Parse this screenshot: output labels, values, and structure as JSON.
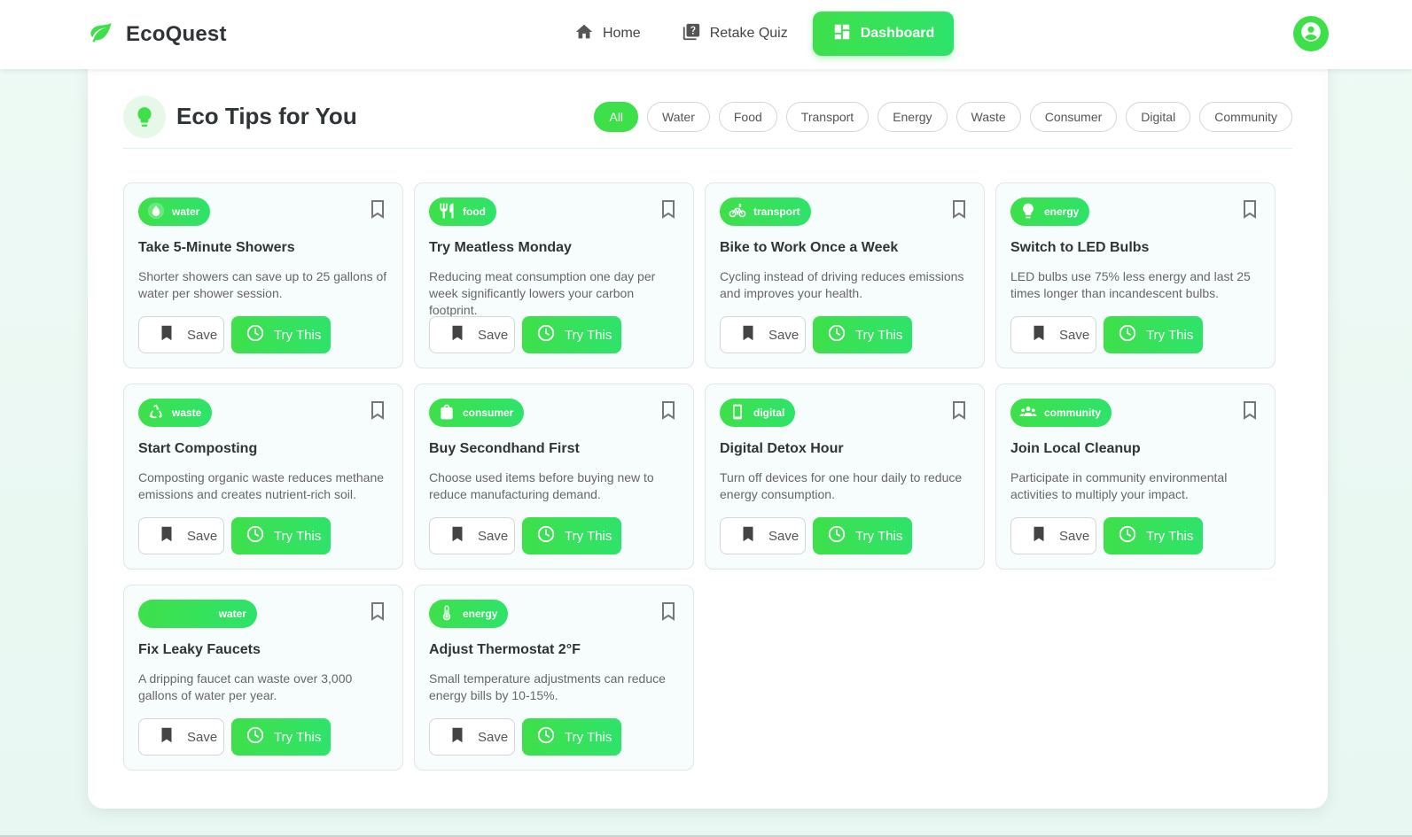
{
  "brand": {
    "name": "EcoQuest",
    "icon": "leaf-icon"
  },
  "nav": [
    {
      "label": "Home",
      "icon": "home-icon",
      "active": false
    },
    {
      "label": "Retake Quiz",
      "icon": "quiz-icon",
      "active": false
    },
    {
      "label": "Dashboard",
      "icon": "dashboard-icon",
      "active": true
    }
  ],
  "user": {
    "icon": "user-avatar-icon"
  },
  "section": {
    "title": "Eco Tips for You",
    "icon": "lightbulb-icon"
  },
  "filters": [
    "All",
    "Water",
    "Food",
    "Transport",
    "Energy",
    "Waste",
    "Consumer",
    "Digital",
    "Community"
  ],
  "active_filter": "All",
  "buttons": {
    "save": "Save",
    "try": "Try This"
  },
  "colors": {
    "accent": "#3ee04a",
    "accent_alt": "#2ee36a",
    "text": "#2f3437"
  },
  "tips": [
    {
      "category": "water",
      "icon": "water-drop-icon",
      "title": "Take 5-Minute Showers",
      "description": "Shorter showers can save up to 25 gallons of water per shower session."
    },
    {
      "category": "food",
      "icon": "fork-knife-icon",
      "title": "Try Meatless Monday",
      "description": "Reducing meat consumption one day per week significantly lowers your carbon footprint."
    },
    {
      "category": "transport",
      "icon": "bicycle-icon",
      "title": "Bike to Work Once a Week",
      "description": "Cycling instead of driving reduces emissions and improves your health."
    },
    {
      "category": "energy",
      "icon": "lightbulb-icon",
      "title": "Switch to LED Bulbs",
      "description": "LED bulbs use 75% less energy and last 25 times longer than incandescent bulbs."
    },
    {
      "category": "waste",
      "icon": "recycle-icon",
      "title": "Start Composting",
      "description": "Composting organic waste reduces methane emissions and creates nutrient-rich soil."
    },
    {
      "category": "consumer",
      "icon": "shopping-bag-icon",
      "title": "Buy Secondhand First",
      "description": "Choose used items before buying new to reduce manufacturing demand."
    },
    {
      "category": "digital",
      "icon": "phone-icon",
      "title": "Digital Detox Hour",
      "description": "Turn off devices for one hour daily to reduce energy consumption."
    },
    {
      "category": "community",
      "icon": "people-icon",
      "title": "Join Local Cleanup",
      "description": "Participate in community environmental activities to multiply your impact."
    },
    {
      "category": "water",
      "icon": "",
      "title": "Fix Leaky Faucets",
      "description": "A dripping faucet can waste over 3,000 gallons of water per year."
    },
    {
      "category": "energy",
      "icon": "thermometer-icon",
      "title": "Adjust Thermostat 2°F",
      "description": "Small temperature adjustments can reduce energy bills by 10-15%."
    }
  ]
}
